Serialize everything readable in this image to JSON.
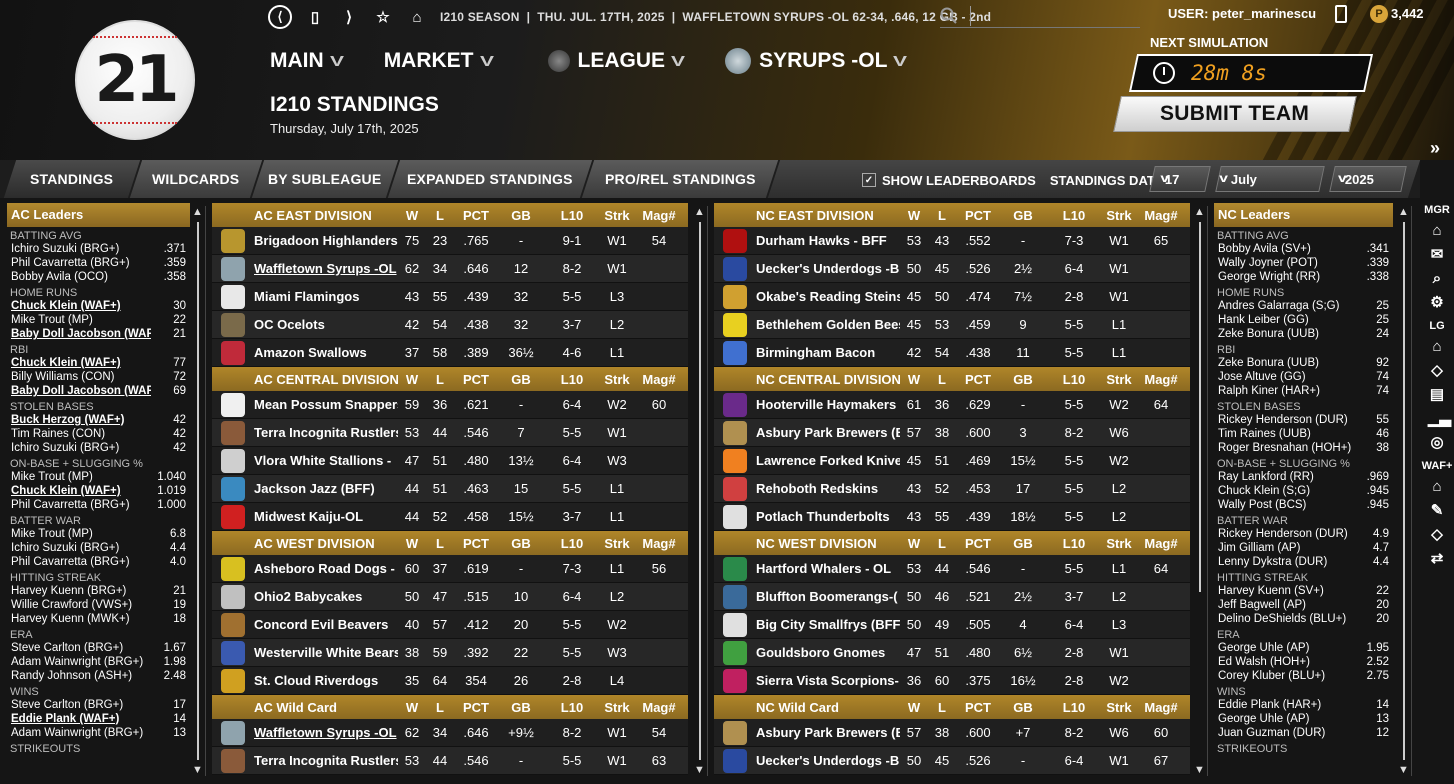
{
  "app": {
    "logo_text": "21",
    "season": "I210 SEASON",
    "date": "THU. JUL. 17TH, 2025",
    "team_record": "WAFFLETOWN SYRUPS -OL  62-34, .646, 12 GB - 2nd",
    "user": "USER: peter_marinescu",
    "coins": "3,442",
    "coin_glyph": "P"
  },
  "nav": {
    "main": "MAIN",
    "market": "MARKET",
    "league": "LEAGUE",
    "team": "SYRUPS -OL"
  },
  "page": {
    "title": "I210 STANDINGS",
    "date": "Thursday, July 17th, 2025"
  },
  "sim": {
    "label": "NEXT SIMULATION",
    "timer": "28m 8s",
    "submit": "SUBMIT TEAM"
  },
  "tabs": [
    "STANDINGS",
    "WILDCARDS",
    "BY SUBLEAGUE",
    "EXPANDED STANDINGS",
    "PRO/REL STANDINGS"
  ],
  "controls": {
    "show_leaderboards": "SHOW LEADERBOARDS",
    "standings_date": "STANDINGS DATE:",
    "day": "17",
    "month": "July",
    "year": "2025"
  },
  "rail": {
    "mgr": "MGR",
    "lg": "LG",
    "waf": "WAF+"
  },
  "cols": {
    "w": "W",
    "l": "L",
    "pct": "PCT",
    "gb": "GB",
    "l10": "L10",
    "strk": "Strk",
    "mag": "Mag#"
  },
  "ac_leaders": {
    "title": "AC Leaders",
    "cats": [
      {
        "name": "BATTING AVG",
        "rows": [
          [
            "Ichiro Suzuki (BRG+)",
            ".371",
            false
          ],
          [
            "Phil Cavarretta (BRG+)",
            ".359",
            false
          ],
          [
            "Bobby Avila (OCO)",
            ".358",
            false
          ]
        ]
      },
      {
        "name": "HOME RUNS",
        "rows": [
          [
            "Chuck Klein (WAF+)",
            "30",
            true
          ],
          [
            "Mike Trout (MP)",
            "22",
            false
          ],
          [
            "Baby Doll Jacobson (WAF+)",
            "21",
            true
          ]
        ]
      },
      {
        "name": "RBI",
        "rows": [
          [
            "Chuck Klein (WAF+)",
            "77",
            true
          ],
          [
            "Billy Williams (CON)",
            "72",
            false
          ],
          [
            "Baby Doll Jacobson (WAF+)",
            "69",
            true
          ]
        ]
      },
      {
        "name": "STOLEN BASES",
        "rows": [
          [
            "Buck Herzog (WAF+)",
            "42",
            true
          ],
          [
            "Tim Raines (CON)",
            "42",
            false
          ],
          [
            "Ichiro Suzuki (BRG+)",
            "42",
            false
          ]
        ]
      },
      {
        "name": "ON-BASE + SLUGGING %",
        "rows": [
          [
            "Mike Trout (MP)",
            "1.040",
            false
          ],
          [
            "Chuck Klein (WAF+)",
            "1.019",
            true
          ],
          [
            "Phil Cavarretta (BRG+)",
            "1.000",
            false
          ]
        ]
      },
      {
        "name": "BATTER WAR",
        "rows": [
          [
            "Mike Trout (MP)",
            "6.8",
            false
          ],
          [
            "Ichiro Suzuki (BRG+)",
            "4.4",
            false
          ],
          [
            "Phil Cavarretta (BRG+)",
            "4.0",
            false
          ]
        ]
      },
      {
        "name": "HITTING STREAK",
        "rows": [
          [
            "Harvey Kuenn (BRG+)",
            "21",
            false
          ],
          [
            "Willie Crawford (VWS+)",
            "19",
            false
          ],
          [
            "Harvey Kuenn (MWK+)",
            "18",
            false
          ]
        ]
      },
      {
        "name": "ERA",
        "rows": [
          [
            "Steve Carlton (BRG+)",
            "1.67",
            false
          ],
          [
            "Adam Wainwright (BRG+)",
            "1.98",
            false
          ],
          [
            "Randy Johnson (ASH+)",
            "2.48",
            false
          ]
        ]
      },
      {
        "name": "WINS",
        "rows": [
          [
            "Steve Carlton (BRG+)",
            "17",
            false
          ],
          [
            "Eddie Plank (WAF+)",
            "14",
            true
          ],
          [
            "Adam Wainwright (BRG+)",
            "13",
            false
          ]
        ]
      },
      {
        "name": "STRIKEOUTS",
        "rows": []
      }
    ]
  },
  "nc_leaders": {
    "title": "NC Leaders",
    "cats": [
      {
        "name": "BATTING AVG",
        "rows": [
          [
            "Bobby Avila (SV+)",
            ".341",
            false
          ],
          [
            "Wally Joyner (POT)",
            ".339",
            false
          ],
          [
            "George Wright (RR)",
            ".338",
            false
          ]
        ]
      },
      {
        "name": "HOME RUNS",
        "rows": [
          [
            "Andres Galarraga (S;G)",
            "25",
            false
          ],
          [
            "Hank Leiber (GG)",
            "25",
            false
          ],
          [
            "Zeke Bonura (UUB)",
            "24",
            false
          ]
        ]
      },
      {
        "name": "RBI",
        "rows": [
          [
            "Zeke Bonura (UUB)",
            "92",
            false
          ],
          [
            "Jose Altuve (GG)",
            "74",
            false
          ],
          [
            "Ralph Kiner (HAR+)",
            "74",
            false
          ]
        ]
      },
      {
        "name": "STOLEN BASES",
        "rows": [
          [
            "Rickey Henderson (DUR)",
            "55",
            false
          ],
          [
            "Tim Raines (UUB)",
            "46",
            false
          ],
          [
            "Roger Bresnahan (HOH+)",
            "38",
            false
          ]
        ]
      },
      {
        "name": "ON-BASE + SLUGGING %",
        "rows": [
          [
            "Ray Lankford (RR)",
            ".969",
            false
          ],
          [
            "Chuck Klein (S;G)",
            ".945",
            false
          ],
          [
            "Wally Post (BCS)",
            ".945",
            false
          ]
        ]
      },
      {
        "name": "BATTER WAR",
        "rows": [
          [
            "Rickey Henderson (DUR)",
            "4.9",
            false
          ],
          [
            "Jim Gilliam (AP)",
            "4.7",
            false
          ],
          [
            "Lenny Dykstra (DUR)",
            "4.4",
            false
          ]
        ]
      },
      {
        "name": "HITTING STREAK",
        "rows": [
          [
            "Harvey Kuenn (SV+)",
            "22",
            false
          ],
          [
            "Jeff Bagwell (AP)",
            "20",
            false
          ],
          [
            "Delino DeShields (BLU+)",
            "20",
            false
          ]
        ]
      },
      {
        "name": "ERA",
        "rows": [
          [
            "George Uhle (AP)",
            "1.95",
            false
          ],
          [
            "Ed Walsh (HOH+)",
            "2.52",
            false
          ],
          [
            "Corey Kluber (BLU+)",
            "2.75",
            false
          ]
        ]
      },
      {
        "name": "WINS",
        "rows": [
          [
            "Eddie Plank (HAR+)",
            "14",
            false
          ],
          [
            "George Uhle (AP)",
            "13",
            false
          ],
          [
            "Juan Guzman (DUR)",
            "12",
            false
          ]
        ]
      },
      {
        "name": "STRIKEOUTS",
        "rows": []
      }
    ]
  },
  "ac": [
    {
      "title": "AC EAST DIVISION",
      "teams": [
        [
          "Brigadoon Highlanders",
          "75",
          "23",
          ".765",
          "-",
          "9-1",
          "W1",
          "54",
          false,
          "#b8962e"
        ],
        [
          "Waffletown Syrups -OL",
          "62",
          "34",
          ".646",
          "12",
          "8-2",
          "W1",
          "",
          true,
          "#8fa3ad"
        ],
        [
          "Miami Flamingos",
          "43",
          "55",
          ".439",
          "32",
          "5-5",
          "L3",
          "",
          false,
          "#e8e8e8"
        ],
        [
          "OC Ocelots",
          "42",
          "54",
          ".438",
          "32",
          "3-7",
          "L2",
          "",
          false,
          "#7a6a4a"
        ],
        [
          "Amazon Swallows",
          "37",
          "58",
          ".389",
          "36½",
          "4-6",
          "L1",
          "",
          false,
          "#c02a3a"
        ]
      ]
    },
    {
      "title": "AC CENTRAL DIVISION",
      "teams": [
        [
          "Mean Possum Snappers",
          "59",
          "36",
          ".621",
          "-",
          "6-4",
          "W2",
          "60",
          false,
          "#f0f0f0"
        ],
        [
          "Terra Incognita Rustlers",
          "53",
          "44",
          ".546",
          "7",
          "5-5",
          "W1",
          "",
          false,
          "#8a5a3a"
        ],
        [
          "Vlora White Stallions -",
          "47",
          "51",
          ".480",
          "13½",
          "6-4",
          "W3",
          "",
          false,
          "#cfcfcf"
        ],
        [
          "Jackson Jazz (BFF)",
          "44",
          "51",
          ".463",
          "15",
          "5-5",
          "L1",
          "",
          false,
          "#3a8ac0"
        ],
        [
          "Midwest Kaiju-OL",
          "44",
          "52",
          ".458",
          "15½",
          "3-7",
          "L1",
          "",
          false,
          "#d02020"
        ]
      ]
    },
    {
      "title": "AC WEST DIVISION",
      "teams": [
        [
          "Asheboro Road Dogs -",
          "60",
          "37",
          ".619",
          "-",
          "7-3",
          "L1",
          "56",
          false,
          "#d8c020"
        ],
        [
          "Ohio2 Babycakes",
          "50",
          "47",
          ".515",
          "10",
          "6-4",
          "L2",
          "",
          false,
          "#c0c0c0"
        ],
        [
          "Concord Evil Beavers",
          "40",
          "57",
          ".412",
          "20",
          "5-5",
          "W2",
          "",
          false,
          "#a07030"
        ],
        [
          "Westerville White Bears",
          "38",
          "59",
          ".392",
          "22",
          "5-5",
          "W3",
          "",
          false,
          "#3a5ab0"
        ],
        [
          "St. Cloud Riverdogs",
          "35",
          "64",
          "354",
          "26",
          "2-8",
          "L4",
          "",
          false,
          "#d0a020"
        ]
      ]
    },
    {
      "title": "AC  Wild Card",
      "teams": [
        [
          "Waffletown Syrups -OL",
          "62",
          "34",
          ".646",
          "+9½",
          "8-2",
          "W1",
          "54",
          true,
          "#8fa3ad"
        ],
        [
          "Terra Incognita Rustlers - C",
          "53",
          "44",
          ".546",
          "-",
          "5-5",
          "W1",
          "63",
          false,
          "#8a5a3a"
        ]
      ]
    }
  ],
  "nc": [
    {
      "title": "NC EAST DIVISION",
      "teams": [
        [
          "Durham Hawks - BFF",
          "53",
          "43",
          ".552",
          "-",
          "7-3",
          "W1",
          "65",
          false,
          "#b01010"
        ],
        [
          "Uecker's Underdogs -B",
          "50",
          "45",
          ".526",
          "2½",
          "6-4",
          "W1",
          "",
          false,
          "#2a4aa0"
        ],
        [
          "Okabe's Reading Steins",
          "45",
          "50",
          ".474",
          "7½",
          "2-8",
          "W1",
          "",
          false,
          "#d0a030"
        ],
        [
          "Bethlehem Golden Bees",
          "45",
          "53",
          ".459",
          "9",
          "5-5",
          "L1",
          "",
          false,
          "#e8d020"
        ],
        [
          "Birmingham Bacon",
          "42",
          "54",
          ".438",
          "11",
          "5-5",
          "L1",
          "",
          false,
          "#4070d0"
        ]
      ]
    },
    {
      "title": "NC CENTRAL DIVISION",
      "teams": [
        [
          "Hooterville Haymakers",
          "61",
          "36",
          ".629",
          "-",
          "5-5",
          "W2",
          "64",
          false,
          "#6a2a8a"
        ],
        [
          "Asbury Park Brewers (B",
          "57",
          "38",
          ".600",
          "3",
          "8-2",
          "W6",
          "",
          false,
          "#b09050"
        ],
        [
          "Lawrence Forked Knives",
          "45",
          "51",
          ".469",
          "15½",
          "5-5",
          "W2",
          "",
          false,
          "#f08020"
        ],
        [
          "Rehoboth Redskins",
          "43",
          "52",
          ".453",
          "17",
          "5-5",
          "L2",
          "",
          false,
          "#d04040"
        ],
        [
          "Potlach Thunderbolts",
          "43",
          "55",
          ".439",
          "18½",
          "5-5",
          "L2",
          "",
          false,
          "#e0e0e0"
        ]
      ]
    },
    {
      "title": "NC WEST DIVISION",
      "teams": [
        [
          "Hartford Whalers - OL",
          "53",
          "44",
          ".546",
          "-",
          "5-5",
          "L1",
          "64",
          false,
          "#2a8a4a"
        ],
        [
          "Bluffton Boomerangs-(",
          "50",
          "46",
          ".521",
          "2½",
          "3-7",
          "L2",
          "",
          false,
          "#3a6a9a"
        ],
        [
          "Big City Smallfrys (BFF)",
          "50",
          "49",
          ".505",
          "4",
          "6-4",
          "L3",
          "",
          false,
          "#e0e0e0"
        ],
        [
          "Gouldsboro Gnomes",
          "47",
          "51",
          ".480",
          "6½",
          "2-8",
          "W1",
          "",
          false,
          "#40a040"
        ],
        [
          "Sierra Vista Scorpions-",
          "36",
          "60",
          ".375",
          "16½",
          "2-8",
          "W2",
          "",
          false,
          "#c02060"
        ]
      ]
    },
    {
      "title": "NC  Wild Card",
      "teams": [
        [
          "Asbury Park Brewers (BFF)",
          "57",
          "38",
          ".600",
          "+7",
          "8-2",
          "W6",
          "60",
          false,
          "#b09050"
        ],
        [
          "Uecker's Underdogs -BFF",
          "50",
          "45",
          ".526",
          "-",
          "6-4",
          "W1",
          "67",
          false,
          "#2a4aa0"
        ]
      ]
    }
  ]
}
